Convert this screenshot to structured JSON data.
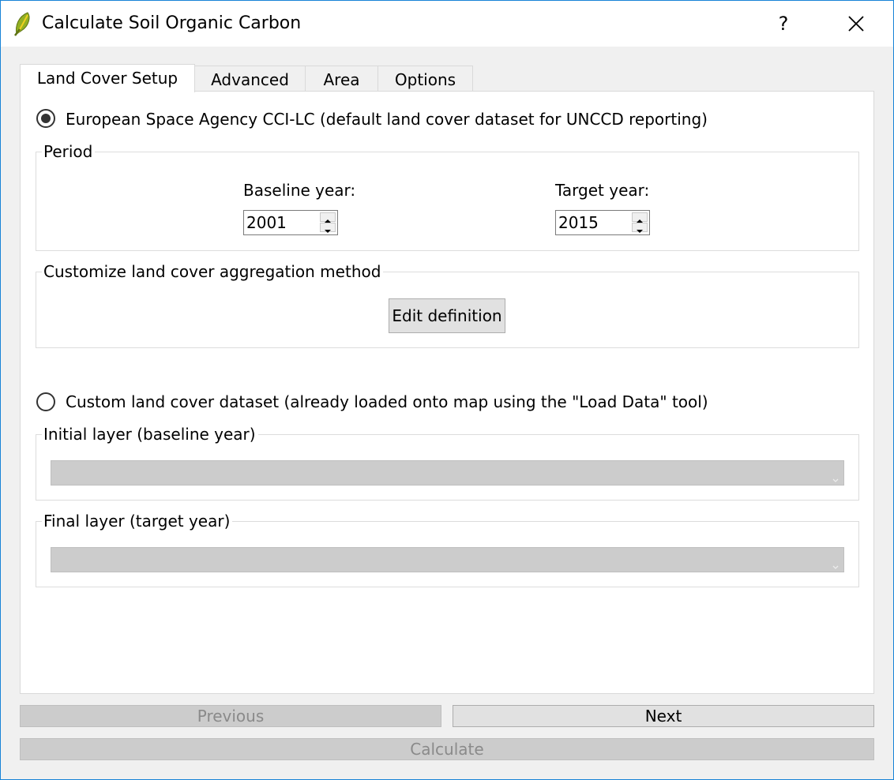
{
  "window": {
    "title": "Calculate Soil Organic Carbon",
    "help_label": "?"
  },
  "tabs": [
    {
      "label": "Land Cover Setup",
      "active": true
    },
    {
      "label": "Advanced",
      "active": false
    },
    {
      "label": "Area",
      "active": false
    },
    {
      "label": "Options",
      "active": false
    }
  ],
  "esa": {
    "radio_label": "European Space Agency CCI-LC (default land cover dataset for UNCCD reporting)",
    "selected": true,
    "period": {
      "title": "Period",
      "baseline_label": "Baseline year:",
      "baseline_value": "2001",
      "target_label": "Target year:",
      "target_value": "2015"
    },
    "aggregation": {
      "title": "Customize land cover aggregation method",
      "edit_button": "Edit definition"
    }
  },
  "custom": {
    "radio_label": "Custom land cover dataset (already loaded onto map using the \"Load Data\" tool)",
    "selected": false,
    "initial_layer": {
      "title": "Initial layer (baseline year)",
      "value": ""
    },
    "final_layer": {
      "title": "Final layer (target year)",
      "value": ""
    }
  },
  "footer": {
    "previous_label": "Previous",
    "next_label": "Next",
    "calculate_label": "Calculate"
  },
  "colors": {
    "accent_border": "#1883d7",
    "disabled_button": "#cccccc"
  }
}
